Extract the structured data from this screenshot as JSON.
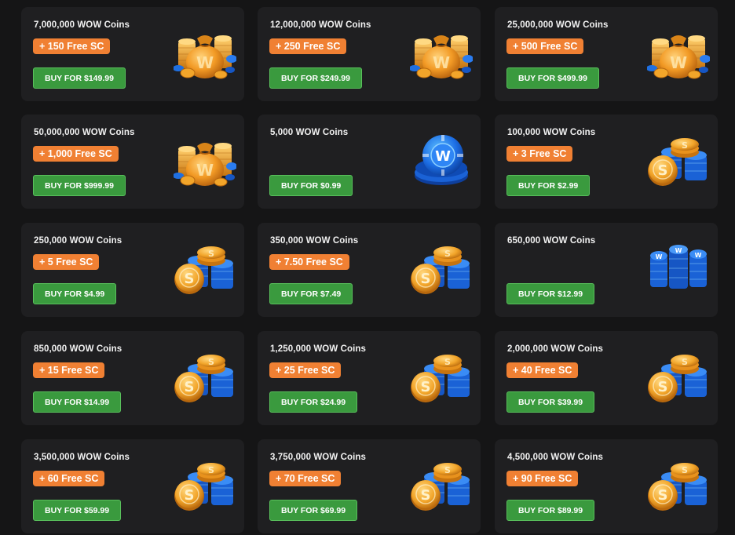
{
  "packages": [
    {
      "coins": "7,000,000 WOW Coins",
      "bonus": "+ 150 Free SC",
      "button": "BUY FOR $149.99",
      "art": "coin-bag-icon"
    },
    {
      "coins": "12,000,000 WOW Coins",
      "bonus": "+ 250 Free SC",
      "button": "BUY FOR $249.99",
      "art": "coin-bag-icon"
    },
    {
      "coins": "25,000,000 WOW Coins",
      "bonus": "+ 500 Free SC",
      "button": "BUY FOR $499.99",
      "art": "coin-bag-icon"
    },
    {
      "coins": "50,000,000 WOW Coins",
      "bonus": "+ 1,000 Free SC",
      "button": "BUY FOR $999.99",
      "art": "coin-bag-icon"
    },
    {
      "coins": "5,000 WOW Coins",
      "bonus": "",
      "button": "BUY FOR $0.99",
      "art": "blue-chip-stack-icon"
    },
    {
      "coins": "100,000 WOW Coins",
      "bonus": "+ 3 Free SC",
      "button": "BUY FOR $2.99",
      "art": "mixed-coin-stack-icon"
    },
    {
      "coins": "250,000 WOW Coins",
      "bonus": "+ 5 Free SC",
      "button": "BUY FOR $4.99",
      "art": "mixed-coin-stack-icon"
    },
    {
      "coins": "350,000 WOW Coins",
      "bonus": "+ 7.50 Free SC",
      "button": "BUY FOR $7.49",
      "art": "mixed-coin-stack-icon"
    },
    {
      "coins": "650,000 WOW Coins",
      "bonus": "",
      "button": "BUY FOR $12.99",
      "art": "blue-chip-pile-icon"
    },
    {
      "coins": "850,000 WOW Coins",
      "bonus": "+ 15 Free SC",
      "button": "BUY FOR $14.99",
      "art": "mixed-coin-stack-icon"
    },
    {
      "coins": "1,250,000 WOW Coins",
      "bonus": "+ 25 Free SC",
      "button": "BUY FOR $24.99",
      "art": "mixed-coin-stack-icon"
    },
    {
      "coins": "2,000,000 WOW Coins",
      "bonus": "+ 40 Free SC",
      "button": "BUY FOR $39.99",
      "art": "mixed-coin-stack-icon"
    },
    {
      "coins": "3,500,000 WOW Coins",
      "bonus": "+ 60 Free SC",
      "button": "BUY FOR $59.99",
      "art": "mixed-coin-stack-icon"
    },
    {
      "coins": "3,750,000 WOW Coins",
      "bonus": "+ 70 Free SC",
      "button": "BUY FOR $69.99",
      "art": "mixed-coin-stack-icon"
    },
    {
      "coins": "4,500,000 WOW Coins",
      "bonus": "+ 90 Free SC",
      "button": "BUY FOR $89.99",
      "art": "mixed-coin-stack-icon"
    }
  ],
  "colors": {
    "page_bg": "#151516",
    "card_bg": "#1f1f21",
    "bonus_badge": "#f08033",
    "buy_button": "#3a9a3e",
    "gold": "#f2a52a",
    "chip_blue": "#1f6fe0"
  }
}
